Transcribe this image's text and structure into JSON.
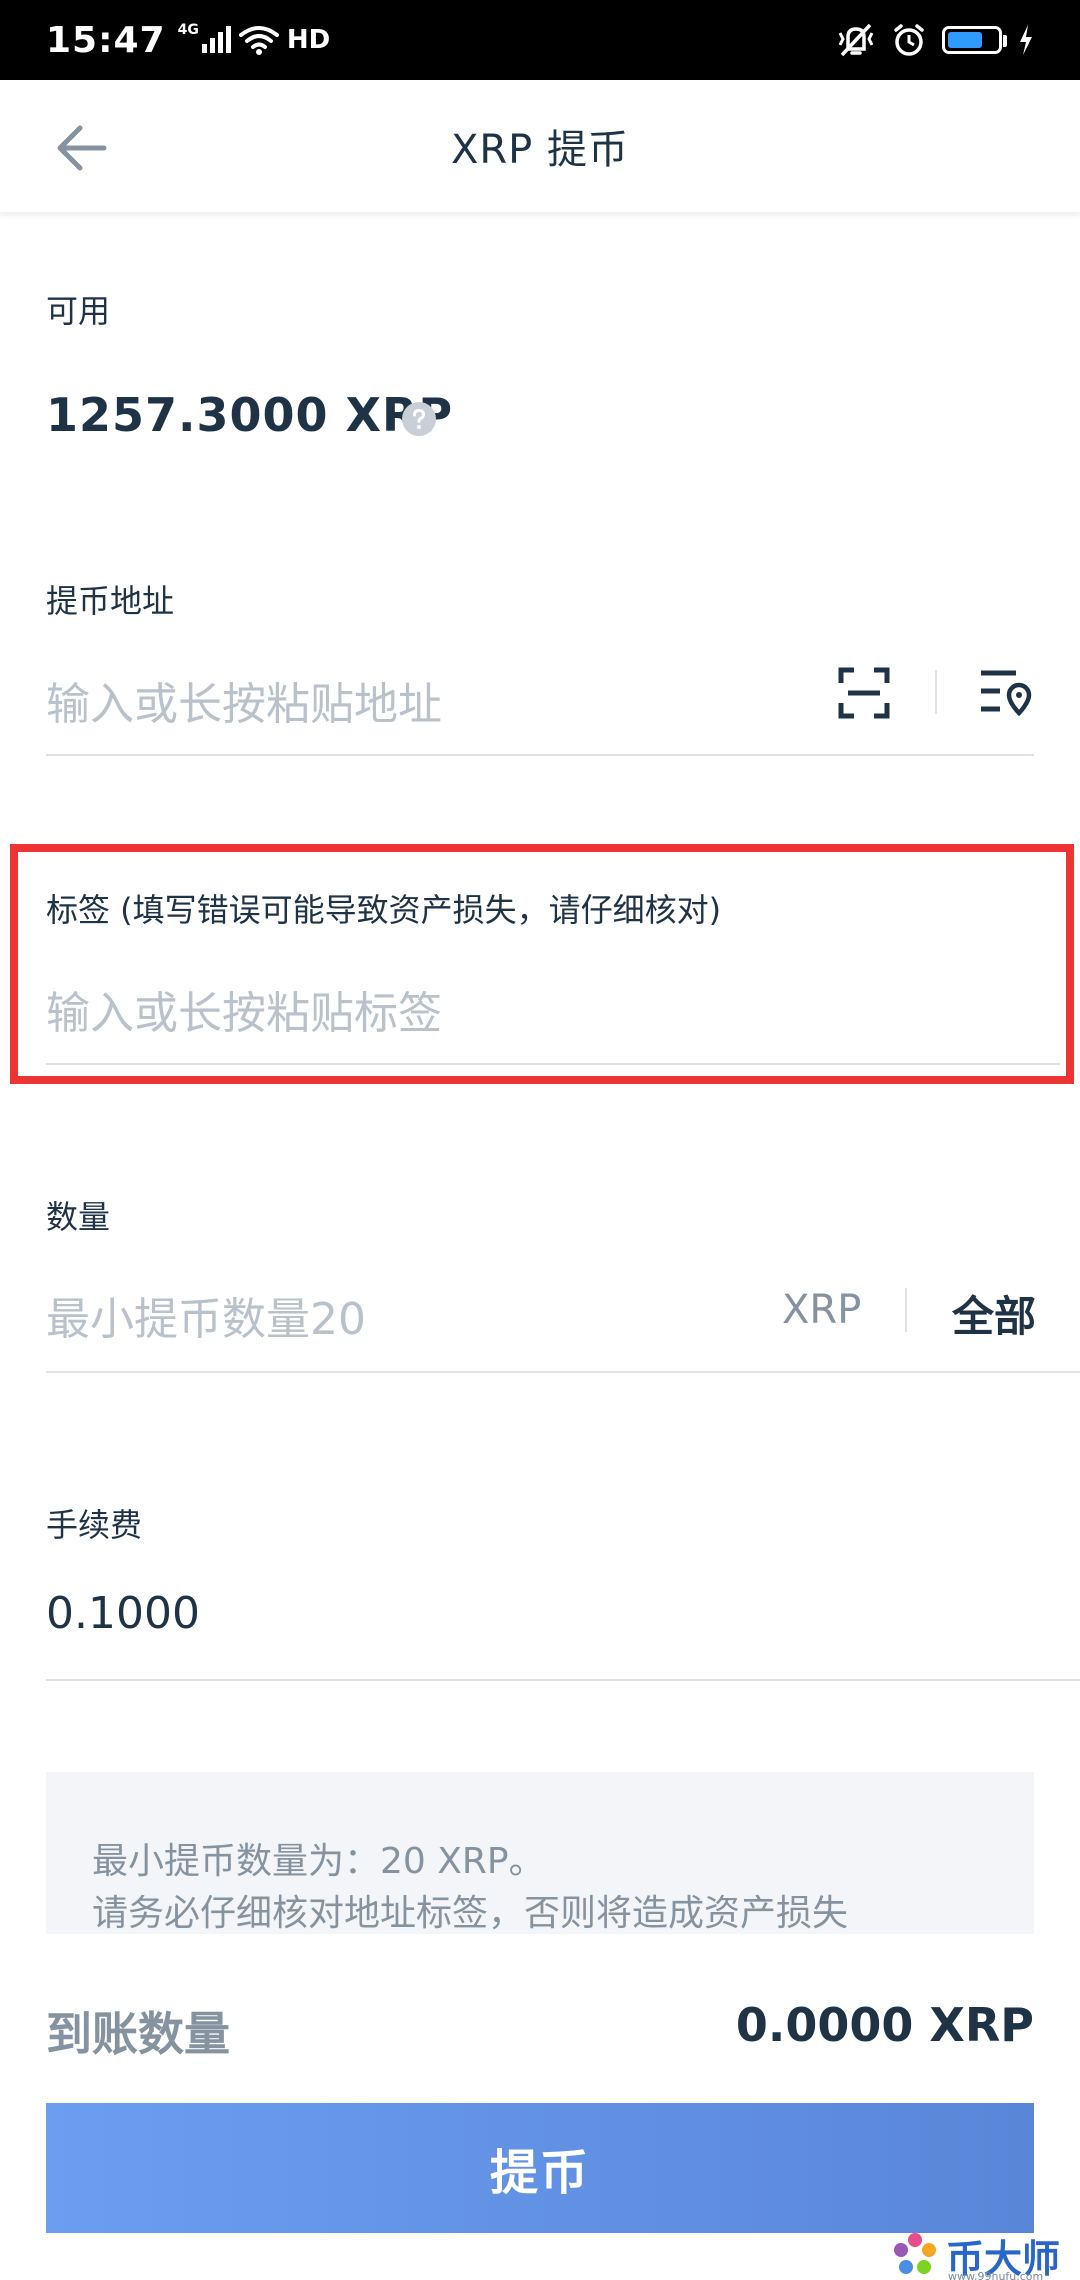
{
  "status_bar": {
    "time": "15:47",
    "network": "4G",
    "hd": "HD",
    "battery_level": 0.7
  },
  "header": {
    "title": "XRP 提币",
    "back_icon": "arrow-left-icon"
  },
  "available": {
    "label": "可用",
    "balance": "1257.3000 XRP",
    "help_icon": "question-circle-icon"
  },
  "address": {
    "label": "提币地址",
    "placeholder": "输入或长按粘贴地址",
    "scan_icon": "scan-qr-icon",
    "addressbook_icon": "address-book-icon"
  },
  "tag": {
    "label": "标签 (填写错误可能导致资产损失，请仔细核对)",
    "placeholder": "输入或长按粘贴标签"
  },
  "amount": {
    "label": "数量",
    "placeholder": "最小提币数量20",
    "unit": "XRP",
    "all_label": "全部"
  },
  "fee": {
    "label": "手续费",
    "value": "0.1000"
  },
  "notice": {
    "lines": [
      "最小提币数量为：20 XRP。",
      "请务必仔细核对地址标签，否则将造成资产损失"
    ]
  },
  "receive": {
    "label": "到账数量",
    "value": "0.0000 XRP"
  },
  "submit": {
    "label": "提币"
  },
  "watermark": {
    "text": "币大师",
    "sub": "www.99hufu.com"
  },
  "colors": {
    "text_primary": "#1f3347",
    "text_muted": "#8592a0",
    "placeholder": "#b9c1cb",
    "divider": "#dde2e8",
    "highlight": "#ee3333",
    "button_start": "#6b9df0",
    "button_end": "#5a86d8"
  }
}
